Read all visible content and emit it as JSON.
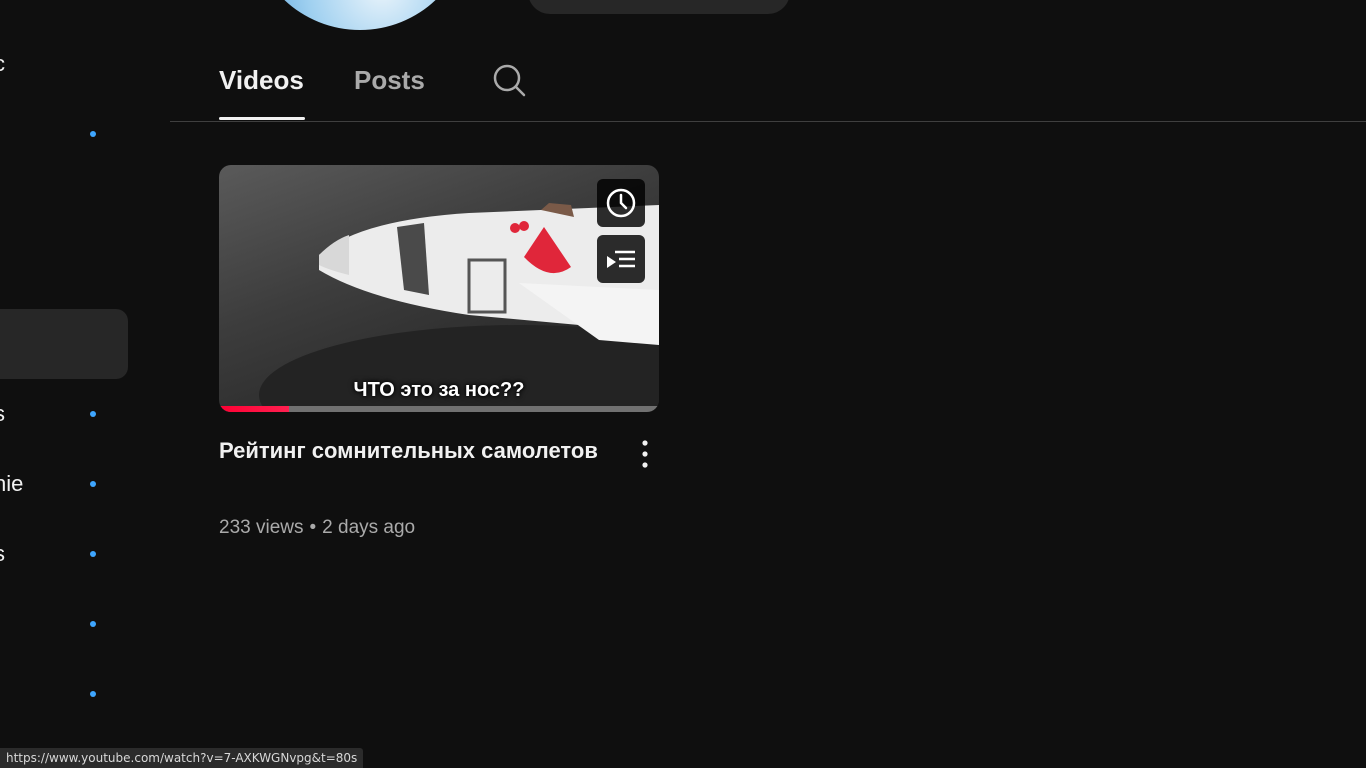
{
  "sidebar": {
    "items": [
      {
        "label": "c",
        "dot": false,
        "active": false
      },
      {
        "label": "",
        "dot": true,
        "active": false
      },
      {
        "label": "",
        "dot": false,
        "active": false
      },
      {
        "label": "",
        "dot": false,
        "active": false
      },
      {
        "label": "",
        "dot": false,
        "active": true
      },
      {
        "label": "s",
        "dot": true,
        "active": false
      },
      {
        "label": "nie",
        "dot": true,
        "active": false
      },
      {
        "label": "s",
        "dot": true,
        "active": false
      },
      {
        "label": "",
        "dot": true,
        "active": false
      },
      {
        "label": "",
        "dot": true,
        "active": false
      }
    ]
  },
  "tabs": {
    "videos": "Videos",
    "posts": "Posts",
    "search_icon": "search-icon"
  },
  "video": {
    "thumbnail_caption": "ЧТО это за нос??",
    "watch_later_icon": "clock-icon",
    "add_to_queue_icon": "queue-icon",
    "title": "Рейтинг сомнительных самолетов",
    "views": "233 views",
    "separator": "•",
    "age": "2 days ago",
    "more_icon": "more-vert-icon",
    "watch_progress": 0.16
  },
  "status_bar": {
    "url": "https://www.youtube.com/watch?v=7-AXKWGNvpg&t=80s"
  },
  "colors": {
    "background": "#0f0f0f",
    "accent_blue": "#3ea6ff",
    "progress_red": "#ff0033"
  }
}
